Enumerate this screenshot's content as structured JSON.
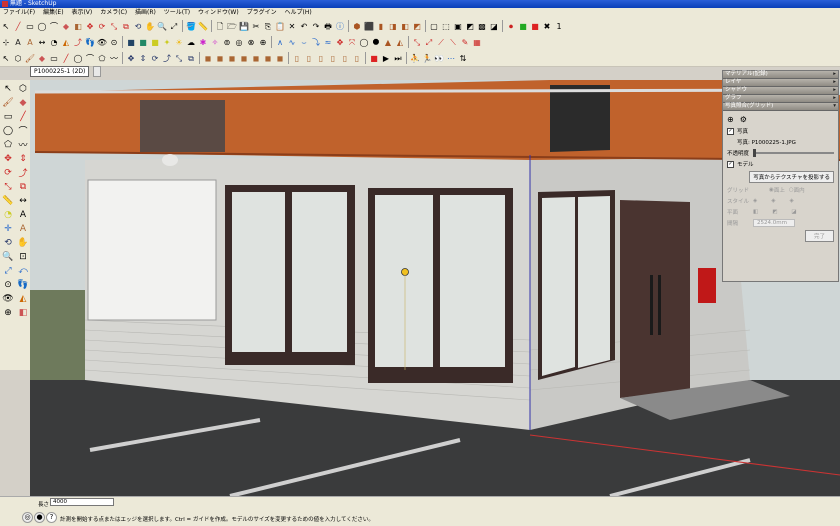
{
  "window": {
    "title": "無題 - SketchUp"
  },
  "menu": [
    "ファイル(F)",
    "編集(E)",
    "表示(V)",
    "カメラ(C)",
    "描画(R)",
    "ツール(T)",
    "ウィンドウ(W)",
    "プラグイン",
    "ヘルプ(H)"
  ],
  "scene_tabs": [
    {
      "label": "P1000225-1 (2D)"
    },
    {
      "label": ""
    }
  ],
  "tray": {
    "panels": [
      "マテリアル(記録)",
      "レイヤ",
      "シャドウ",
      "グラフ",
      "写真照合(グリッド)"
    ],
    "photo": {
      "photo_checkbox": "写真",
      "photo_label": "写真: P1000225-1.JPG",
      "opacity_label": "不透明度",
      "model_checkbox": "モデル",
      "project_button": "写真からテクスチャを投影する",
      "grid_label": "グリッド",
      "grid_opt1": "面上",
      "grid_opt2": "面内",
      "style_label": "スタイル",
      "plane_label": "平面",
      "spacing_label": "間隔",
      "spacing_value": "2524.0mm",
      "done_button": "完了"
    }
  },
  "status": {
    "measure_label": "長さ",
    "measure_value": "4000",
    "message": "計測を開始する点またはエッジを選択します。Ctrl = ガイドを作成。モデルのサイズを変更するための値を入力してください。"
  },
  "colors": {
    "awning": "#c0622c",
    "wall": "#d6d6d2",
    "window": "#dfe3e0",
    "frame": "#3a2a28",
    "asphalt": "#3a3b3c",
    "sky": "#cfd6d6"
  }
}
